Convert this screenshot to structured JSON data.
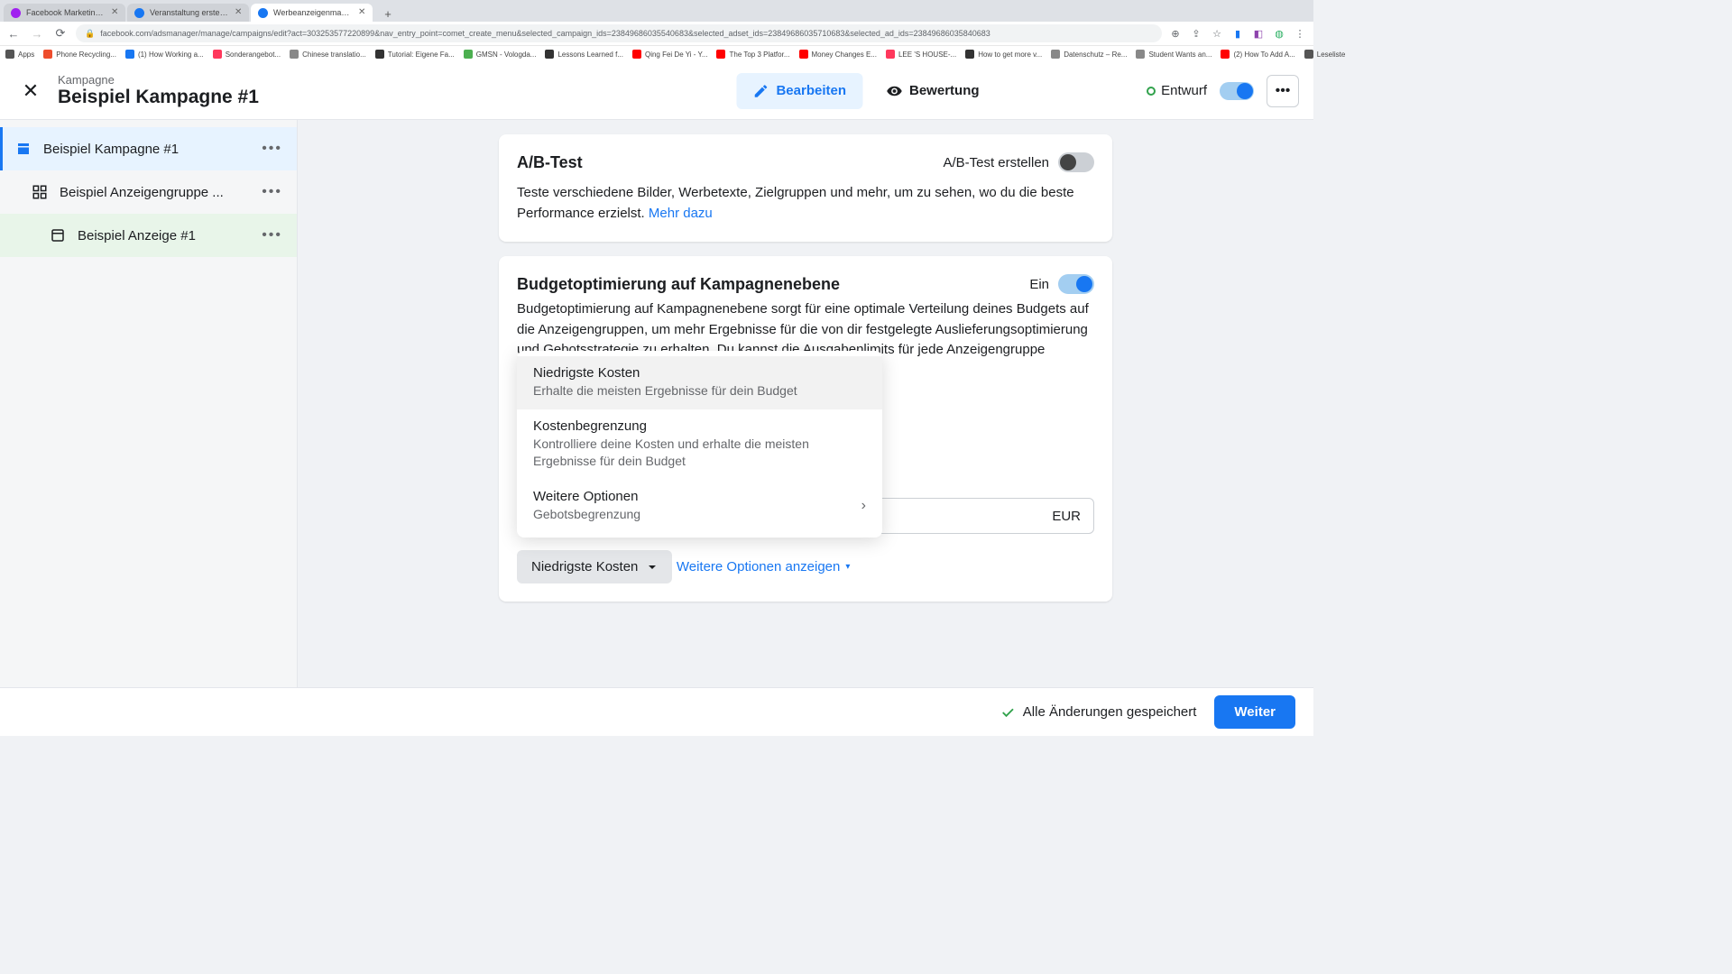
{
  "browser": {
    "tabs": [
      {
        "title": "Facebook Marketing & Werbe...",
        "favicon": "#a020f0"
      },
      {
        "title": "Veranstaltung erstellen | Face...",
        "favicon": "#1877f2"
      },
      {
        "title": "Werbeanzeigenmanager - We...",
        "favicon": "#1877f2",
        "active": true
      }
    ],
    "url": "facebook.com/adsmanager/manage/campaigns/edit?act=303253577220899&nav_entry_point=comet_create_menu&selected_campaign_ids=23849686035540683&selected_adset_ids=23849686035710683&selected_ad_ids=23849686035840683",
    "bookmarks": [
      {
        "label": "Apps",
        "color": "#555"
      },
      {
        "label": "Phone Recycling...",
        "color": "#ee4d2d"
      },
      {
        "label": "(1) How Working a...",
        "color": "#1877f2"
      },
      {
        "label": "Sonderangebot...",
        "color": "#ff385c"
      },
      {
        "label": "Chinese translatio...",
        "color": "#888"
      },
      {
        "label": "Tutorial: Eigene Fa...",
        "color": "#333"
      },
      {
        "label": "GMSN - Vologda...",
        "color": "#4caf50"
      },
      {
        "label": "Lessons Learned f...",
        "color": "#333"
      },
      {
        "label": "Qing Fei De Yi - Y...",
        "color": "#ff0000"
      },
      {
        "label": "The Top 3 Platfor...",
        "color": "#ff0000"
      },
      {
        "label": "Money Changes E...",
        "color": "#ff0000"
      },
      {
        "label": "LEE 'S HOUSE-...",
        "color": "#ff385c"
      },
      {
        "label": "How to get more v...",
        "color": "#333"
      },
      {
        "label": "Datenschutz – Re...",
        "color": "#888"
      },
      {
        "label": "Student Wants an...",
        "color": "#888"
      },
      {
        "label": "(2) How To Add A...",
        "color": "#ff0000"
      },
      {
        "label": "Leseliste",
        "color": "#555",
        "reading": true
      }
    ]
  },
  "header": {
    "label": "Kampagne",
    "title": "Beispiel Kampagne #1",
    "edit": "Bearbeiten",
    "review": "Bewertung",
    "draft": "Entwurf"
  },
  "sidebar": {
    "items": [
      {
        "label": "Beispiel Kampagne #1",
        "type": "campaign",
        "active": true
      },
      {
        "label": "Beispiel Anzeigengruppe ...",
        "type": "adset"
      },
      {
        "label": "Beispiel Anzeige #1",
        "type": "ad",
        "green": true
      }
    ]
  },
  "abtest": {
    "title": "A/B-Test",
    "toggle_label": "A/B-Test erstellen",
    "desc": "Teste verschiedene Bilder, Werbetexte, Zielgruppen und mehr, um zu sehen, wo du die beste Performance erzielst.",
    "link": "Mehr dazu"
  },
  "budget": {
    "title": "Budgetoptimierung auf Kampagnenebene",
    "toggle_label": "Ein",
    "desc": "Budgetoptimierung auf Kampagnenebene sorgt für eine optimale Verteilung deines Budgets auf die Anzeigengruppen, um mehr Ergebnisse für die von dir festgelegte Auslieferungsoptimierung und Gebotsstrategie zu erhalten. Du kannst die Ausgabenlimits für jede Anzeigengruppe kontrollieren.",
    "currency": "EUR",
    "selected_strategy": "Niedrigste Kosten",
    "show_more": "Weitere Optionen anzeigen"
  },
  "dropdown": {
    "options": [
      {
        "title": "Niedrigste Kosten",
        "desc": "Erhalte die meisten Ergebnisse für dein Budget"
      },
      {
        "title": "Kostenbegrenzung",
        "desc": "Kontrolliere deine Kosten und erhalte die meisten Ergebnisse für dein Budget"
      },
      {
        "title": "Weitere Optionen",
        "desc": "Gebotsbegrenzung",
        "submenu": true
      }
    ]
  },
  "footer": {
    "saved": "Alle Änderungen gespeichert",
    "next": "Weiter"
  }
}
